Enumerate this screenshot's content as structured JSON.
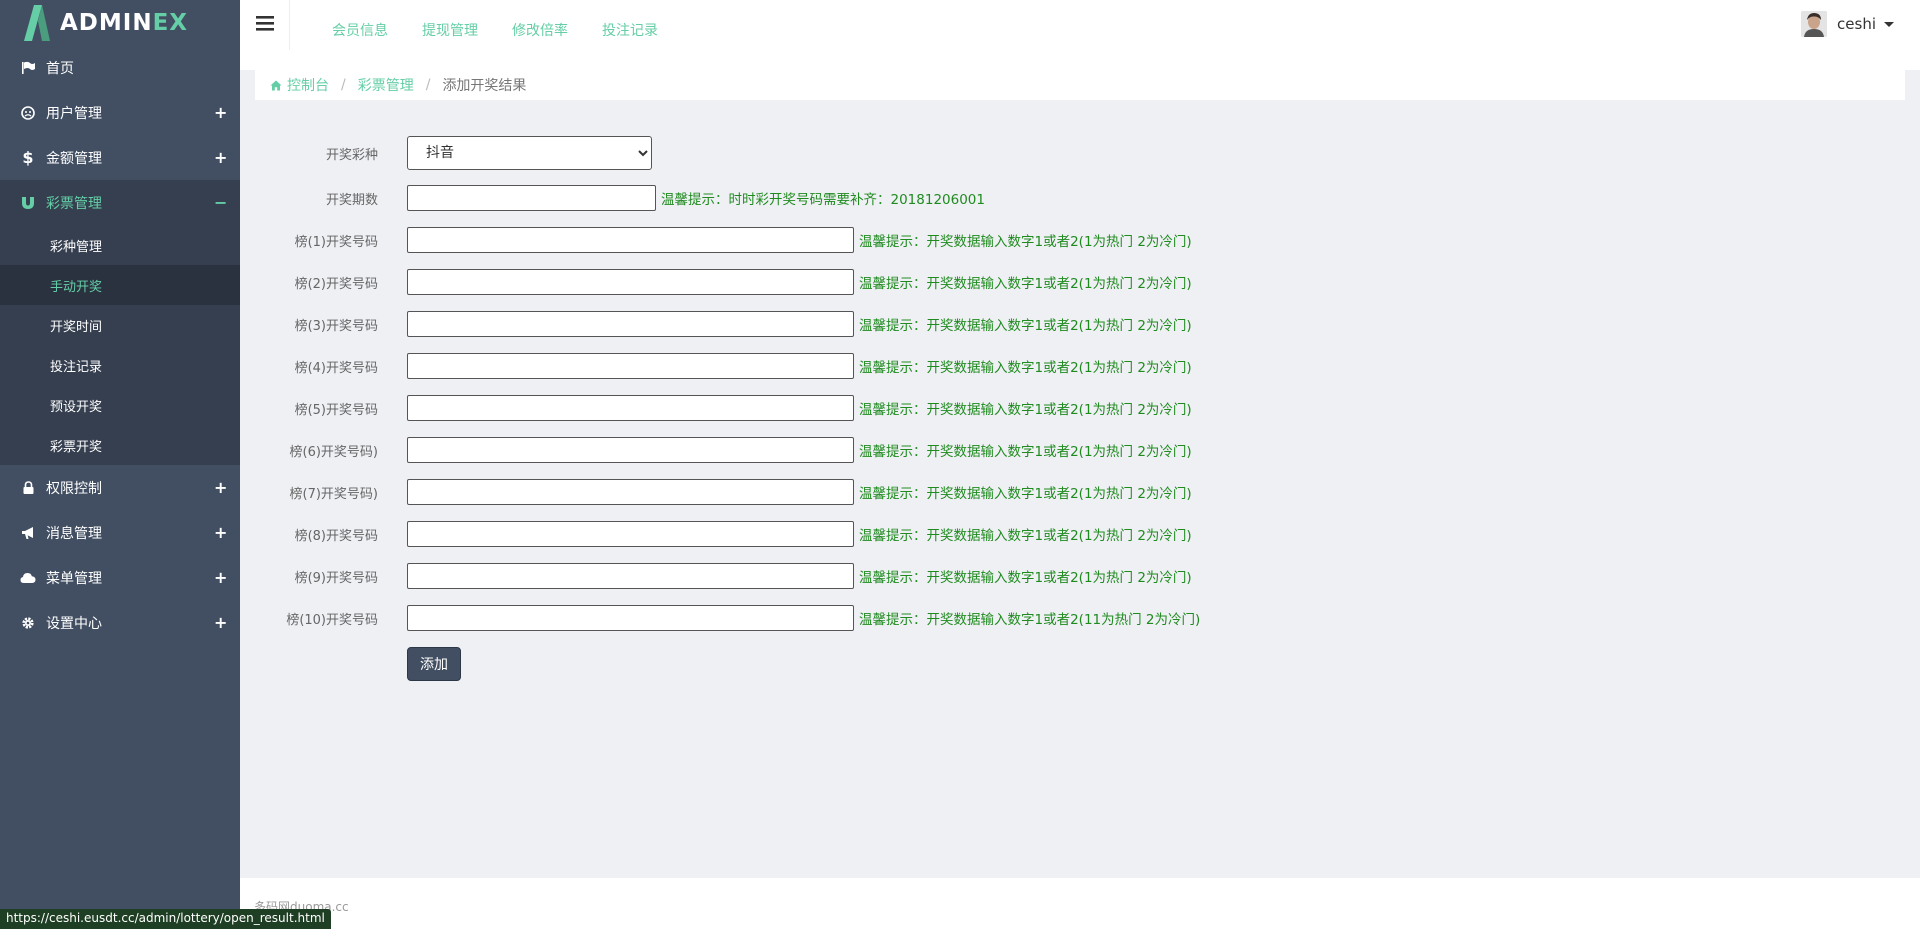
{
  "logo": {
    "text_main": "ADMIN",
    "text_accent": "EX"
  },
  "sidebar": {
    "items": [
      {
        "label": "首页",
        "icon": "flag-icon",
        "toggle": ""
      },
      {
        "label": "用户管理",
        "icon": "user-circle-icon",
        "toggle": "+"
      },
      {
        "label": "金额管理",
        "icon": "dollar-icon",
        "toggle": "+"
      },
      {
        "label": "彩票管理",
        "icon": "magnet-icon",
        "toggle": "−"
      },
      {
        "label": "权限控制",
        "icon": "lock-icon",
        "toggle": "+"
      },
      {
        "label": "消息管理",
        "icon": "bullhorn-icon",
        "toggle": "+"
      },
      {
        "label": "菜单管理",
        "icon": "cloud-icon",
        "toggle": "+"
      },
      {
        "label": "设置中心",
        "icon": "gear-icon",
        "toggle": "+"
      }
    ],
    "submenu": [
      {
        "label": "彩种管理"
      },
      {
        "label": "手动开奖"
      },
      {
        "label": "开奖时间"
      },
      {
        "label": "投注记录"
      },
      {
        "label": "预设开奖"
      },
      {
        "label": "彩票开奖"
      }
    ]
  },
  "header": {
    "nav": [
      "会员信息",
      "提现管理",
      "修改倍率",
      "投注记录"
    ],
    "user_name": "ceshi"
  },
  "breadcrumb": {
    "home": "控制台",
    "parent": "彩票管理",
    "current": "添加开奖结果"
  },
  "form": {
    "lottery_type": {
      "label": "开奖彩种",
      "selected": "抖音"
    },
    "period": {
      "label": "开奖期数",
      "value": "",
      "tip": "温馨提示：时时彩开奖号码需要补齐：20181206001"
    },
    "rows": [
      {
        "label": "榜(1)开奖号码",
        "tip": "温馨提示：开奖数据输入数字1或者2(1为热门 2为冷门)"
      },
      {
        "label": "榜(2)开奖号码",
        "tip": "温馨提示：开奖数据输入数字1或者2(1为热门 2为冷门)"
      },
      {
        "label": "榜(3)开奖号码",
        "tip": "温馨提示：开奖数据输入数字1或者2(1为热门 2为冷门)"
      },
      {
        "label": "榜(4)开奖号码",
        "tip": "温馨提示：开奖数据输入数字1或者2(1为热门 2为冷门)"
      },
      {
        "label": "榜(5)开奖号码",
        "tip": "温馨提示：开奖数据输入数字1或者2(1为热门 2为冷门)"
      },
      {
        "label": "榜(6)开奖号码)",
        "tip": "温馨提示：开奖数据输入数字1或者2(1为热门 2为冷门)"
      },
      {
        "label": "榜(7)开奖号码)",
        "tip": "温馨提示：开奖数据输入数字1或者2(1为热门 2为冷门)"
      },
      {
        "label": "榜(8)开奖号码",
        "tip": "温馨提示：开奖数据输入数字1或者2(1为热门 2为冷门)"
      },
      {
        "label": "榜(9)开奖号码",
        "tip": "温馨提示：开奖数据输入数字1或者2(1为热门 2为冷门)"
      },
      {
        "label": "榜(10)开奖号码",
        "tip": "温馨提示：开奖数据输入数字1或者2(11为热门 2为冷门)"
      }
    ],
    "submit_label": "添加"
  },
  "footer": {
    "text": "多码网duoma.cc"
  },
  "status_url": "https://ceshi.eusdt.cc/admin/lottery/open_result.html",
  "colors": {
    "sidebar": "#424f63",
    "accent": "#65cea7",
    "tip": "#1f8b1f"
  }
}
